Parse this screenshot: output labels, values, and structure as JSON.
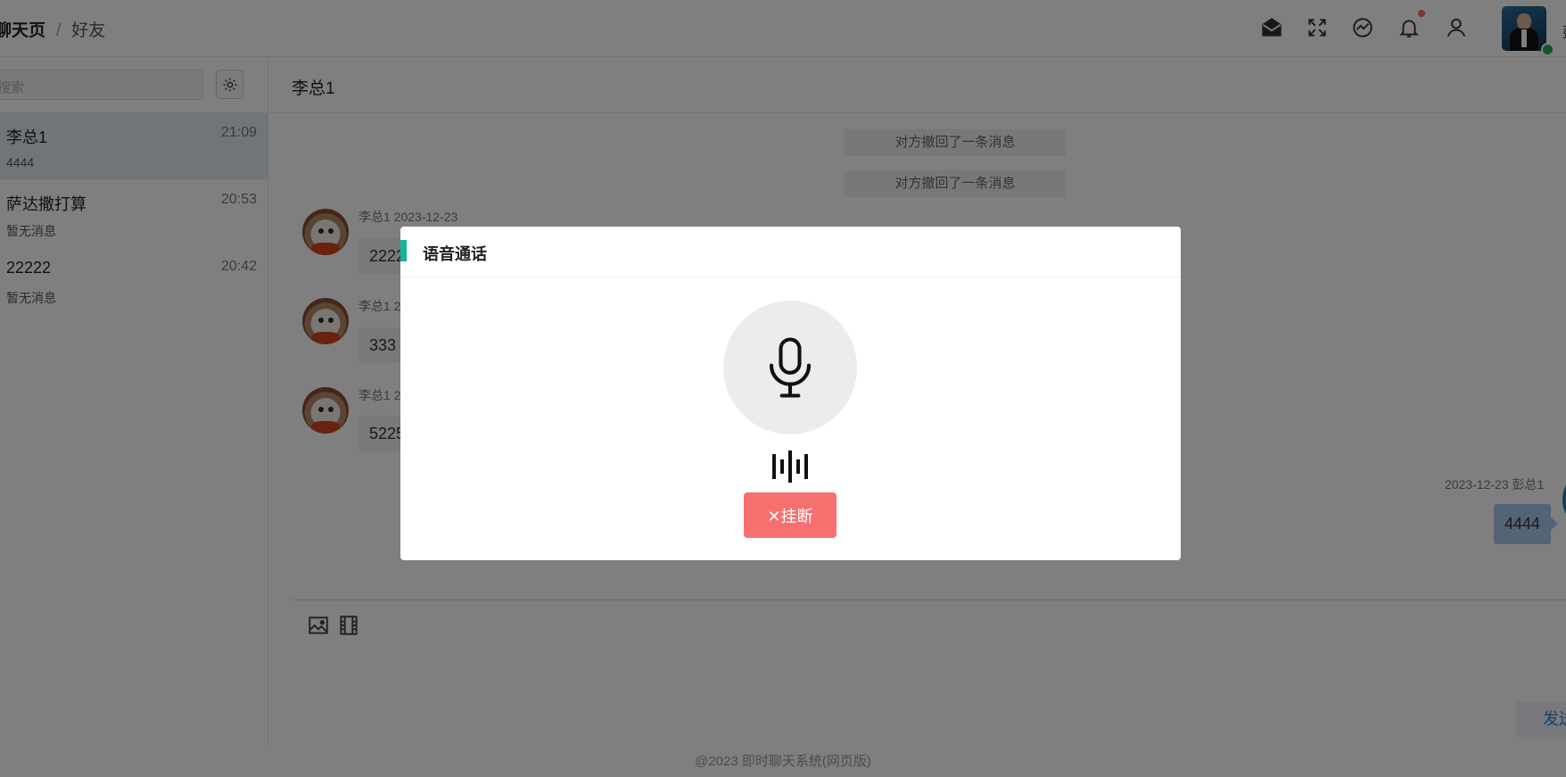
{
  "header": {
    "breadcrumb": {
      "current": "聊天页",
      "separator": "/",
      "link": "好友"
    },
    "icons": [
      "mail-icon",
      "fullscreen-icon",
      "theme-icon",
      "bell-icon",
      "user-icon"
    ],
    "notification_dot_color": "#f56c6c",
    "username_partial": "彭"
  },
  "sidebar": {
    "search_placeholder": "搜索",
    "settings_icon": "gear-icon",
    "conversations": [
      {
        "name": "李总1",
        "time": "21:09",
        "last_message": "4444",
        "active": true
      },
      {
        "name": "萨达撒打算",
        "time": "20:53",
        "last_message": "暂无消息",
        "active": false
      },
      {
        "name": "22222",
        "time": "20:42",
        "last_message": "暂无消息",
        "active": false
      }
    ]
  },
  "chat": {
    "title": "李总1",
    "system_messages": [
      "对方撤回了一条消息",
      "对方撤回了一条消息"
    ],
    "messages": [
      {
        "meta": "李总1 2023-12-23",
        "text": "2222"
      },
      {
        "meta": "李总1 2",
        "text": "333"
      },
      {
        "meta": "李总1 2",
        "text": "5225"
      }
    ],
    "own_message": {
      "meta": "2023-12-23 彭总1",
      "text": "4444"
    },
    "toolbar_icons": [
      "image-icon",
      "video-icon"
    ],
    "send_label": "发送"
  },
  "footer": {
    "text": "@2023 即时聊天系统(网页版)"
  },
  "dialog": {
    "title": "语音通话",
    "accent_color": "#14b59b",
    "mic_icon": "microphone-icon",
    "wave_icon": "sound-wave-icon",
    "hangup_label": "✕挂断",
    "hangup_color": "#f77070"
  }
}
